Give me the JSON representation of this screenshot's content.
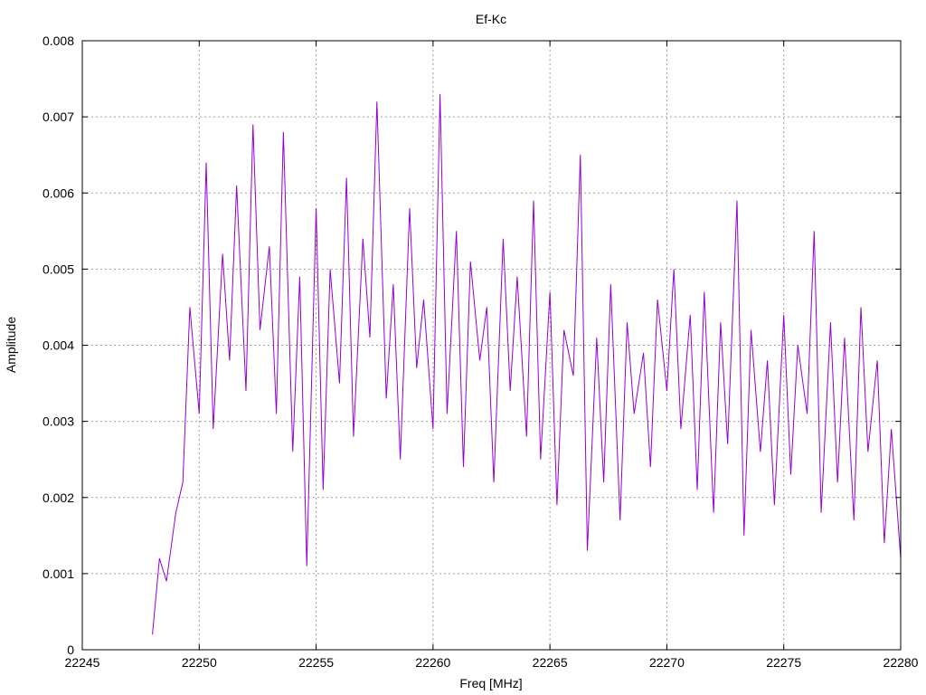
{
  "chart_data": {
    "type": "line",
    "title": "Ef-Kc",
    "xlabel": "Freq [MHz]",
    "ylabel": "Amplitude",
    "xlim": [
      22245,
      22280
    ],
    "ylim": [
      0,
      0.008
    ],
    "grid": true,
    "legend": "none",
    "x_ticks": [
      22245,
      22250,
      22255,
      22260,
      22265,
      22270,
      22275,
      22280
    ],
    "x_tick_labels": [
      "22245",
      "22250",
      "22255",
      "22260",
      "22265",
      "22270",
      "22275",
      "22280"
    ],
    "y_ticks": [
      0,
      0.001,
      0.002,
      0.003,
      0.004,
      0.005,
      0.006,
      0.007,
      0.008
    ],
    "y_tick_labels": [
      "0",
      "0.001",
      "0.002",
      "0.003",
      "0.004",
      "0.005",
      "0.006",
      "0.007",
      "0.008"
    ],
    "series": [
      {
        "color": "#9400d3",
        "x": [
          22248.0,
          22248.3,
          22248.6,
          22249.0,
          22249.3,
          22249.6,
          22250.0,
          22250.3,
          22250.6,
          22251.0,
          22251.3,
          22251.6,
          22252.0,
          22252.3,
          22252.6,
          22253.0,
          22253.3,
          22253.6,
          22254.0,
          22254.3,
          22254.6,
          22255.0,
          22255.3,
          22255.6,
          22256.0,
          22256.3,
          22256.6,
          22257.0,
          22257.3,
          22257.6,
          22258.0,
          22258.3,
          22258.6,
          22259.0,
          22259.3,
          22259.6,
          22260.0,
          22260.3,
          22260.6,
          22261.0,
          22261.3,
          22261.6,
          22262.0,
          22262.3,
          22262.6,
          22263.0,
          22263.3,
          22263.6,
          22264.0,
          22264.3,
          22264.6,
          22265.0,
          22265.3,
          22265.6,
          22266.0,
          22266.3,
          22266.6,
          22267.0,
          22267.3,
          22267.6,
          22268.0,
          22268.3,
          22268.6,
          22269.0,
          22269.3,
          22269.6,
          22270.0,
          22270.3,
          22270.6,
          22271.0,
          22271.3,
          22271.6,
          22272.0,
          22272.3,
          22272.6,
          22273.0,
          22273.3,
          22273.6,
          22274.0,
          22274.3,
          22274.6,
          22275.0,
          22275.3,
          22275.6,
          22276.0,
          22276.3,
          22276.6,
          22277.0,
          22277.3,
          22277.6,
          22278.0,
          22278.3,
          22278.6,
          22279.0,
          22279.3,
          22279.6,
          22280.0
        ],
        "y": [
          0.0002,
          0.0012,
          0.0009,
          0.0018,
          0.0022,
          0.0045,
          0.0031,
          0.0064,
          0.0029,
          0.0052,
          0.0038,
          0.0061,
          0.0034,
          0.0069,
          0.0042,
          0.0053,
          0.0031,
          0.0068,
          0.0026,
          0.0049,
          0.0011,
          0.0058,
          0.0021,
          0.005,
          0.0035,
          0.0062,
          0.0028,
          0.0054,
          0.0041,
          0.0072,
          0.0033,
          0.0048,
          0.0025,
          0.0058,
          0.0037,
          0.0046,
          0.0029,
          0.0073,
          0.0031,
          0.0055,
          0.0024,
          0.0051,
          0.0038,
          0.0045,
          0.0022,
          0.0054,
          0.0034,
          0.0049,
          0.0028,
          0.0059,
          0.0025,
          0.0047,
          0.0019,
          0.0042,
          0.0036,
          0.0065,
          0.0013,
          0.0041,
          0.0022,
          0.0048,
          0.0017,
          0.0043,
          0.0031,
          0.0039,
          0.0024,
          0.0046,
          0.0034,
          0.005,
          0.0029,
          0.0044,
          0.0021,
          0.0047,
          0.0018,
          0.0043,
          0.0027,
          0.0059,
          0.0015,
          0.0042,
          0.0026,
          0.0038,
          0.0019,
          0.0044,
          0.0023,
          0.004,
          0.0031,
          0.0055,
          0.0018,
          0.0043,
          0.0022,
          0.0041,
          0.0017,
          0.0045,
          0.0026,
          0.0038,
          0.0014,
          0.0029,
          0.0012
        ]
      }
    ]
  }
}
